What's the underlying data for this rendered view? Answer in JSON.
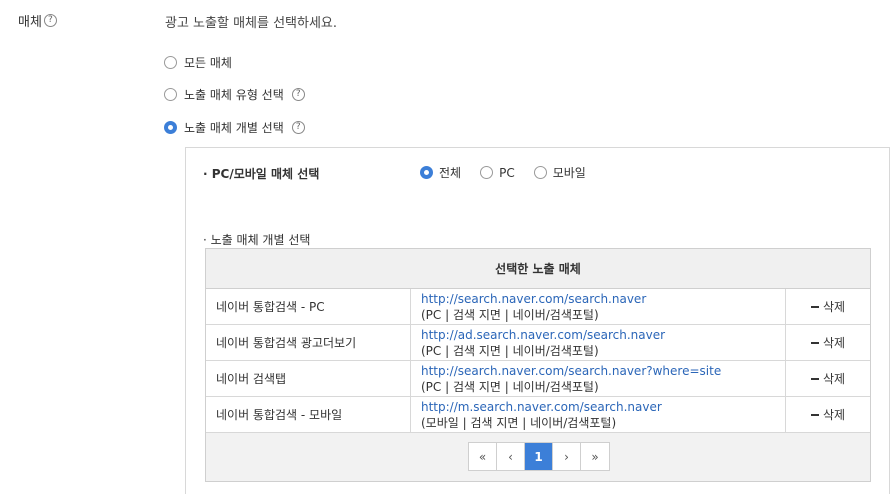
{
  "field_label": "매체",
  "help_glyph": "?",
  "description": "광고 노출할 매체를 선택하세요.",
  "media_options": [
    {
      "label": "모든 매체",
      "selected": false,
      "help": false
    },
    {
      "label": "노출 매체 유형 선택",
      "selected": false,
      "help": true
    },
    {
      "label": "노출 매체 개별 선택",
      "selected": true,
      "help": true
    }
  ],
  "device_section": {
    "title": "· PC/모바일 매체 선택",
    "options": [
      {
        "label": "전체",
        "selected": true
      },
      {
        "label": "PC",
        "selected": false
      },
      {
        "label": "모바일",
        "selected": false
      }
    ]
  },
  "individual_section": {
    "title": "· 노출 매체 개별 선택",
    "table_header": "선택한 노출 매체",
    "rows": [
      {
        "name": "네이버 통합검색 - PC",
        "url": "http://search.naver.com/search.naver",
        "meta": "(PC | 검색 지면 | 네이버/검색포털)",
        "action": "삭제"
      },
      {
        "name": "네이버 통합검색 광고더보기",
        "url": "http://ad.search.naver.com/search.naver",
        "meta": "(PC | 검색 지면 | 네이버/검색포털)",
        "action": "삭제"
      },
      {
        "name": "네이버 검색탭",
        "url": "http://search.naver.com/search.naver?where=site",
        "meta": "(PC | 검색 지면 | 네이버/검색포털)",
        "action": "삭제"
      },
      {
        "name": "네이버 통합검색 - 모바일",
        "url": "http://m.search.naver.com/search.naver",
        "meta": "(모바일 | 검색 지면 | 네이버/검색포털)",
        "action": "삭제"
      }
    ]
  },
  "pagination": {
    "first": "«",
    "prev": "‹",
    "current_page": "1",
    "next": "›",
    "last": "»"
  },
  "colors": {
    "accent": "#3c7fd8",
    "link": "#2b66b8"
  }
}
